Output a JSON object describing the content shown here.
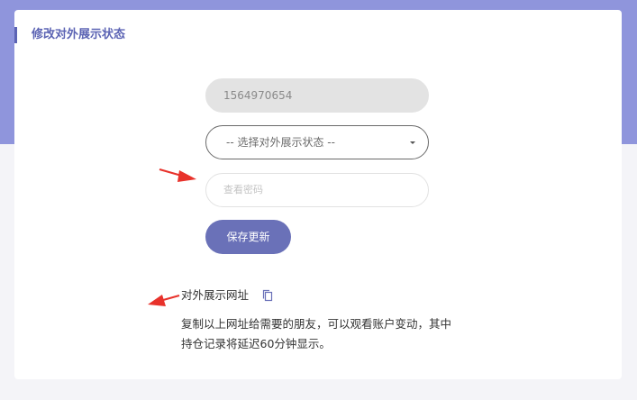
{
  "card": {
    "title": "修改对外展示状态"
  },
  "form": {
    "account_id": "1564970654",
    "select_placeholder": "-- 选择对外展示状态 --",
    "password_placeholder": "查看密码",
    "save_label": "保存更新"
  },
  "share": {
    "url_label": "对外展示网址",
    "note": "复制以上网址给需要的朋友，可以观看账户变动，其中持仓记录将延迟60分钟显示。"
  },
  "colors": {
    "header_band": "#8f95dc",
    "accent": "#5c64b4",
    "button": "#6a71b8",
    "arrow": "#e8322b"
  }
}
